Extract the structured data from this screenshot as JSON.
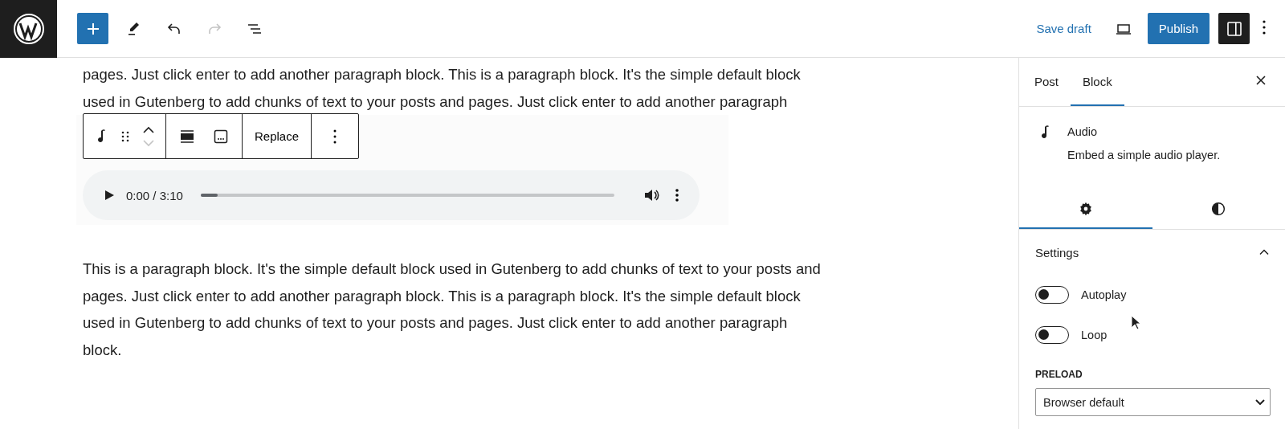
{
  "top_bar": {
    "left_tools": [
      {
        "kind": "add",
        "disabled": false
      },
      {
        "kind": "tools",
        "disabled": false
      },
      {
        "kind": "undo",
        "disabled": false
      },
      {
        "kind": "redo",
        "disabled": true
      },
      {
        "kind": "list",
        "disabled": false
      }
    ],
    "save_draft": "Save draft",
    "publish": "Publish",
    "settings_pressed": true
  },
  "editor": {
    "paragraphs": [
      {
        "lines": [
          "pages. Just click enter to add another paragraph block. This is a paragraph block. It's the simple default block",
          "used in Gutenberg to add chunks of text to your posts and pages. Just click enter to add another paragraph"
        ]
      },
      {
        "lines": [
          "This is a paragraph block. It's the simple default block used in Gutenberg to add chunks of text to your posts and",
          "pages. Just click enter to add another paragraph block. This is a paragraph block. It's the simple default block",
          "used in Gutenberg to add chunks of text to your posts and pages. Just click enter to add another paragraph",
          "block."
        ]
      }
    ],
    "block_toolbar": {
      "move_up_disabled": false,
      "move_down_disabled": true,
      "replace": "Replace"
    },
    "audio_player": {
      "time": "0:00 / 3:10",
      "level": 0.04
    }
  },
  "sidebar": {
    "tabs": [
      {
        "label": "Post",
        "selected": false
      },
      {
        "label": "Block",
        "selected": true
      }
    ],
    "block_card": {
      "title": "Audio",
      "description": "Embed a simple audio player."
    },
    "inspector_tabs": [
      {
        "kind": "settings",
        "selected": true
      },
      {
        "kind": "styles",
        "selected": false
      }
    ],
    "settings_panel": {
      "title": "Settings",
      "expanded": true,
      "toggles": [
        {
          "label": "Autoplay",
          "on": false
        },
        {
          "label": "Loop",
          "on": false
        }
      ],
      "preload_label": "PRELOAD",
      "preload_value": "Browser default"
    }
  }
}
